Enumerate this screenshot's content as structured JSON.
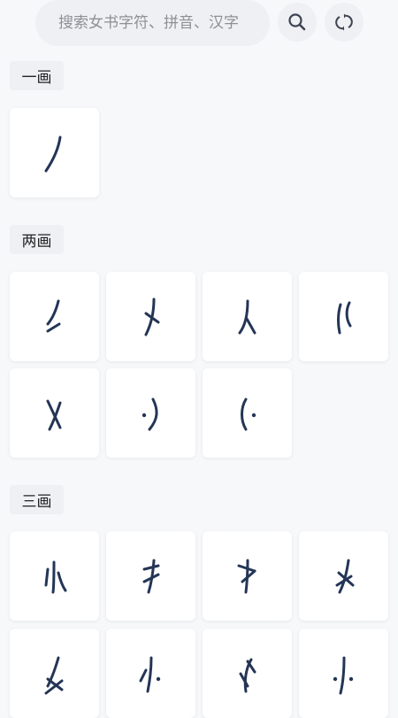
{
  "search": {
    "placeholder": "搜索女书字符、拼音、汉字",
    "value": ""
  },
  "icons": {
    "search": "search-icon",
    "refresh": "refresh-icon"
  },
  "sections": [
    {
      "label": "一画",
      "glyphs": [
        "glyph-1-1"
      ]
    },
    {
      "label": "两画",
      "glyphs": [
        "glyph-2-1",
        "glyph-2-2",
        "glyph-2-3",
        "glyph-2-4",
        "glyph-2-5",
        "glyph-2-6",
        "glyph-2-7"
      ]
    },
    {
      "label": "三画",
      "glyphs": [
        "glyph-3-1",
        "glyph-3-2",
        "glyph-3-3",
        "glyph-3-4",
        "glyph-3-5",
        "glyph-3-6",
        "glyph-3-7",
        "glyph-3-8"
      ]
    }
  ],
  "colors": {
    "background": "#f7f8fa",
    "glyph": "#243556",
    "chip": "#eef0f3"
  }
}
